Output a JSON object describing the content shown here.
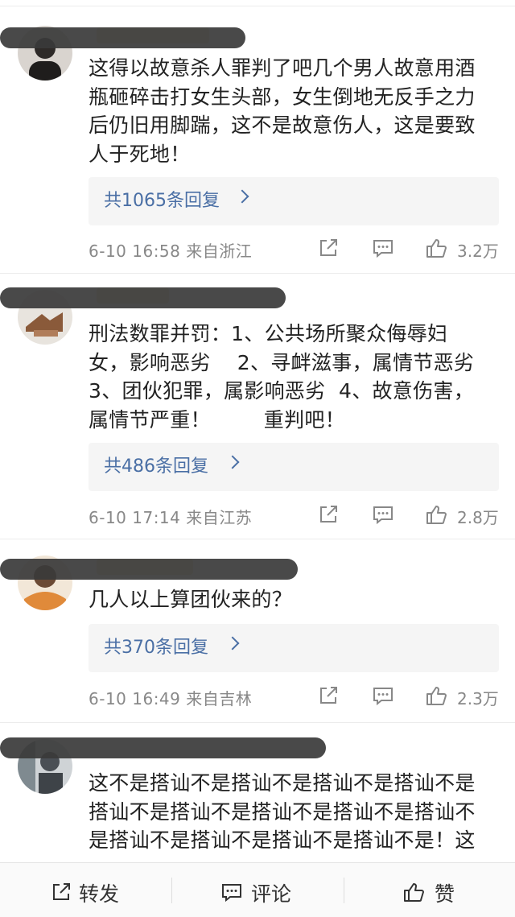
{
  "comments": [
    {
      "content": "这得以故意杀人罪判了吧几个男人故意用酒\n瓶砸碎击打女生头部，女生倒地无反手之力\n后仍旧用脚踹，这不是故意伤人，这是要致\n人于死地！",
      "replies": "共1065条回复",
      "date": "6-10  16:58  来自浙江",
      "likes": "3.2万"
    },
    {
      "content": "刑法数罪并罚：1、公共场所聚众侮辱妇\n女，影响恶劣    2、寻衅滋事，属情节恶劣\n3、团伙犯罪，属影响恶劣  4、故意伤害，\n属情节严重！        重判吧！",
      "replies": "共486条回复",
      "date": "6-10  17:14  来自江苏",
      "likes": "2.8万"
    },
    {
      "content": "几人以上算团伙来的？",
      "replies": "共370条回复",
      "date": "6-10  16:49  来自吉林",
      "likes": "2.3万"
    },
    {
      "content": "这不是搭讪不是搭讪不是搭讪不是搭讪不是\n搭讪不是搭讪不是搭讪不是搭讪不是搭讪不\n是搭讪不是搭讪不是搭讪不是搭讪不是！这",
      "replies": "",
      "date": "",
      "likes": ""
    }
  ],
  "icons": {
    "repost": "repost-icon",
    "comment": "comment-icon",
    "like": "thumbs-up-icon",
    "reply_chevron": "chevron-right-icon"
  },
  "bottom_bar": {
    "repost_label": "转发",
    "comment_label": "评论",
    "like_label": "赞"
  },
  "colors": {
    "link": "#4a6fa5",
    "meta": "#888888",
    "reply_bg": "#f5f5f5"
  }
}
